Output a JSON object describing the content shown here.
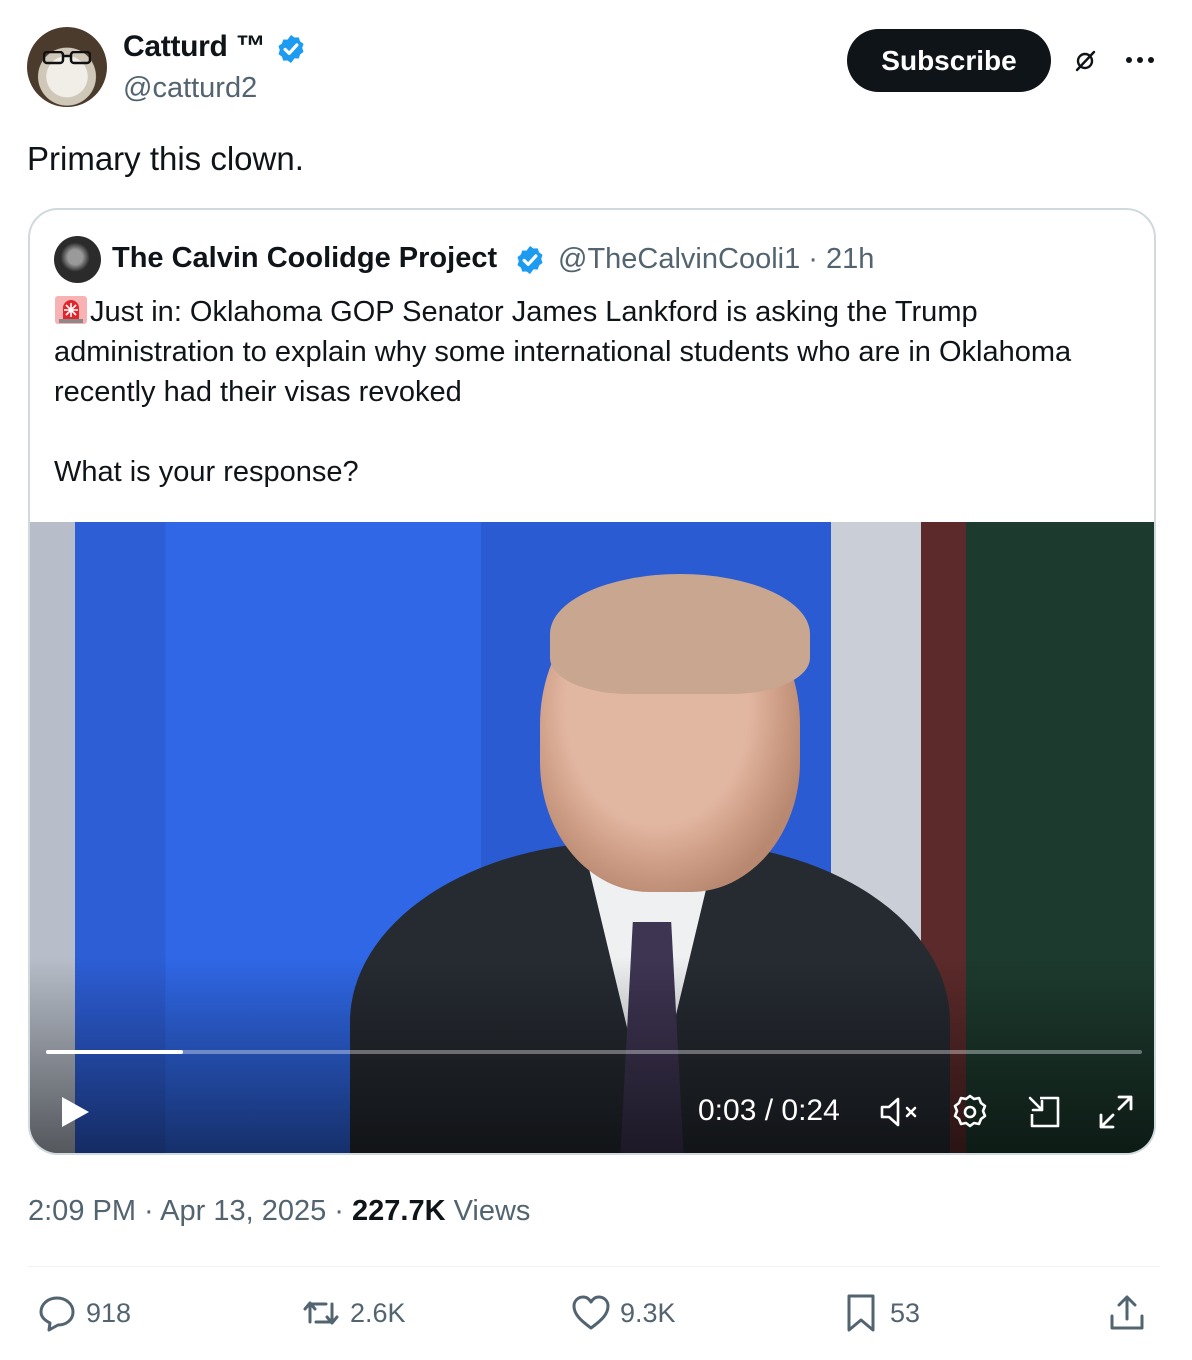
{
  "author": {
    "name": "Catturd ™",
    "handle": "@catturd2",
    "subscribe_label": "Subscribe"
  },
  "post": {
    "text": "Primary this clown."
  },
  "quote": {
    "name": "The Calvin Coolidge Project",
    "handle_time": "@TheCalvinCooli1 · 21h",
    "text": "Just in: Oklahoma GOP Senator James Lankford is asking the Trump administration to explain why some international students who are in Oklahoma recently had their visas revoked\n\nWhat is your response?",
    "text_icon": "siren-emoji"
  },
  "video": {
    "time": "0:03 / 0:24",
    "progress": 0.125,
    "controls": [
      "play-icon",
      "mute-icon",
      "settings-icon",
      "pip-icon",
      "fullscreen-icon"
    ]
  },
  "meta": {
    "time_date": "2:09 PM · Apr 13, 2025 · ",
    "views_count": "227.7K",
    "views_label": " Views"
  },
  "actions": {
    "replies": "918",
    "reposts": "2.6K",
    "likes": "9.3K",
    "bookmarks": "53"
  },
  "colors": {
    "verified": "#1d9bf0",
    "text_secondary": "#536471",
    "button_bg": "#0f1419"
  }
}
